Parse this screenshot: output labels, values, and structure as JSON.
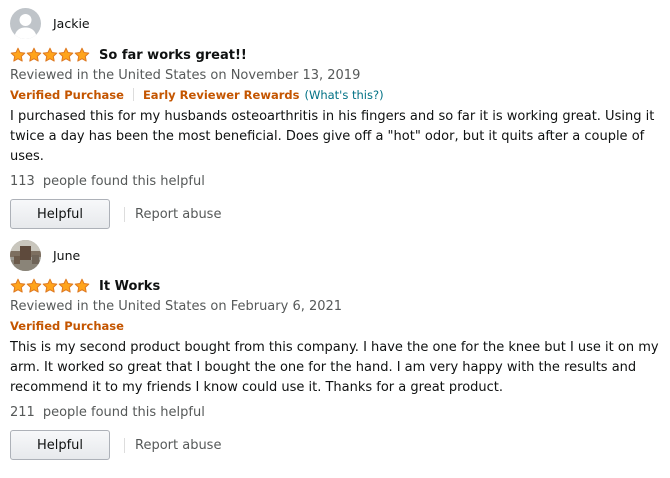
{
  "reviews": [
    {
      "reviewer": "Jackie",
      "rating": 5,
      "rating_max": 5,
      "title": "So far works great!!",
      "date": "Reviewed in the United States on November 13, 2019",
      "verified": "Verified Purchase",
      "early_reviewer": "Early Reviewer Rewards",
      "whats_this": "(What's this?)",
      "body": "I purchased this for my husbands osteoarthritis in his fingers and so far it is working great. Using it twice a day has been the most beneficial. Does give off a \"hot\" odor, but it quits after a couple of uses.",
      "helpful_count": "113",
      "helpful_text": "people found this helpful",
      "helpful_button": "Helpful",
      "report": "Report abuse"
    },
    {
      "reviewer": "June",
      "rating": 5,
      "rating_max": 5,
      "title": "It Works",
      "date": "Reviewed in the United States on February 6, 2021",
      "verified": "Verified Purchase",
      "body": "This is my second product bought from this company. I have the one for the knee but I use it on my arm. It worked so great that I bought the one for the hand. I am very happy with the results and recommend it to my friends I know could use it. Thanks for a great product.",
      "helpful_count": "211",
      "helpful_text": "people found this helpful",
      "helpful_button": "Helpful",
      "report": "Report abuse"
    }
  ],
  "colors": {
    "star_fill": "#ffa41c",
    "star_stroke": "#de7921",
    "badge": "#c45500",
    "link": "#007185",
    "muted": "#565959"
  },
  "icons": {
    "avatar_default": "default-avatar-icon",
    "avatar_photo": "photo-avatar-icon",
    "star": "star-icon"
  }
}
